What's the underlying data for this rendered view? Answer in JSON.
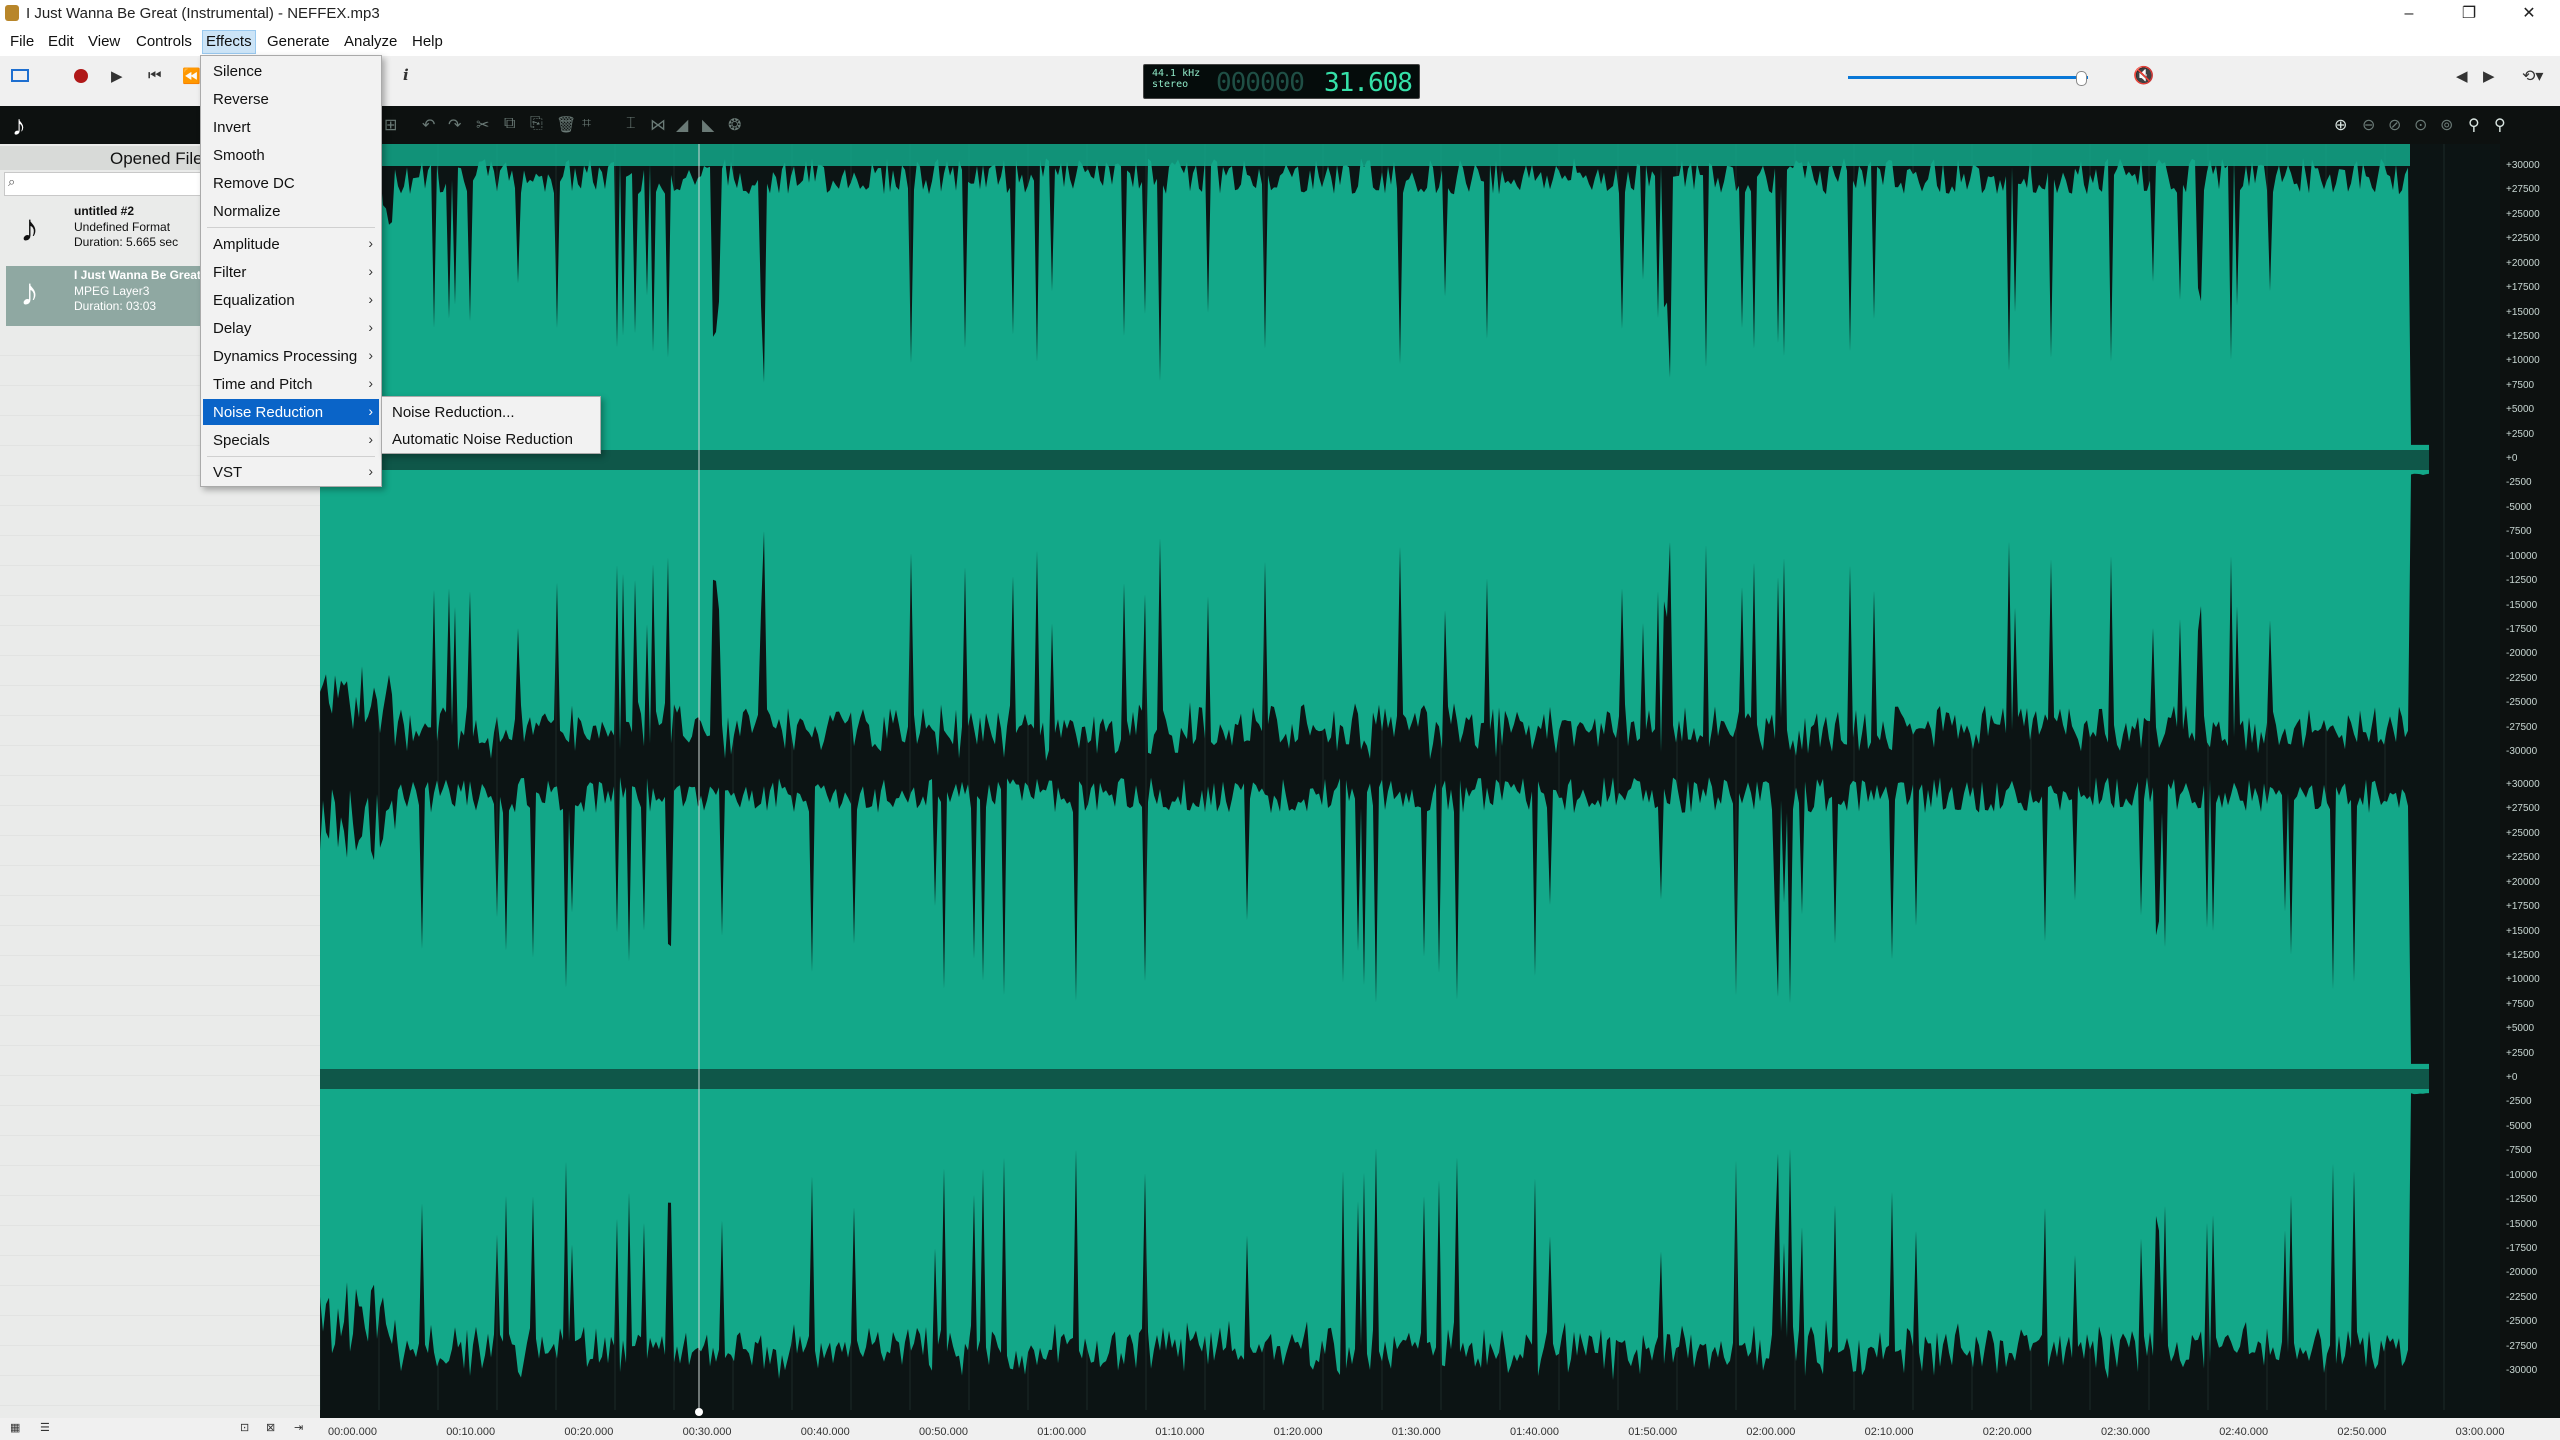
{
  "window": {
    "title": "I Just Wanna Be Great (Instrumental) - NEFFEX.mp3",
    "controls": [
      "–",
      "❐",
      "✕"
    ]
  },
  "menubar": [
    "File",
    "Edit",
    "View",
    "Controls",
    "Effects",
    "Generate",
    "Analyze",
    "Help"
  ],
  "toolbar": {
    "info_label": "i",
    "sample_rate": "44.1 kHz",
    "channels": "stereo",
    "time_dim": "000000",
    "time_value": "31.608",
    "volume_fraction": 0.97
  },
  "left_panel": {
    "title": "Opened Files",
    "search_placeholder": "",
    "files": [
      {
        "name": "untitled #2",
        "format": "Undefined Format",
        "duration": "Duration: 5.665 sec"
      },
      {
        "name": "I Just Wanna Be Great",
        "format": "MPEG Layer3",
        "duration": "Duration: 03:03"
      }
    ]
  },
  "effects_menu": {
    "group1": [
      "Silence",
      "Reverse",
      "Invert",
      "Smooth",
      "Remove DC",
      "Normalize"
    ],
    "group2": [
      "Amplitude",
      "Filter",
      "Equalization",
      "Delay",
      "Dynamics Processing",
      "Time and Pitch",
      "Noise Reduction",
      "Specials"
    ],
    "group3": [
      "VST"
    ],
    "highlighted": "Noise Reduction"
  },
  "noise_reduction_submenu": [
    "Noise Reduction...",
    "Automatic Noise Reduction"
  ],
  "amplitude_scale": [
    "+30000",
    "+27500",
    "+25000",
    "+22500",
    "+20000",
    "+17500",
    "+15000",
    "+12500",
    "+10000",
    "+7500",
    "+5000",
    "+2500",
    "+0",
    "-2500",
    "-5000",
    "-7500",
    "-10000",
    "-12500",
    "-15000",
    "-17500",
    "-20000",
    "-22500",
    "-25000",
    "-27500",
    "-30000"
  ],
  "timeline": [
    "00:00.000",
    "00:10.000",
    "00:20.000",
    "00:30.000",
    "00:40.000",
    "00:50.000",
    "01:00.000",
    "01:10.000",
    "01:20.000",
    "01:30.000",
    "01:40.000",
    "01:50.000",
    "02:00.000",
    "02:10.000",
    "02:20.000",
    "02:30.000",
    "02:40.000",
    "02:50.000",
    "03:00.000"
  ],
  "colors": {
    "waveform": "#13a889",
    "background": "#0c1414",
    "menu_highlight": "#0a64c8"
  }
}
